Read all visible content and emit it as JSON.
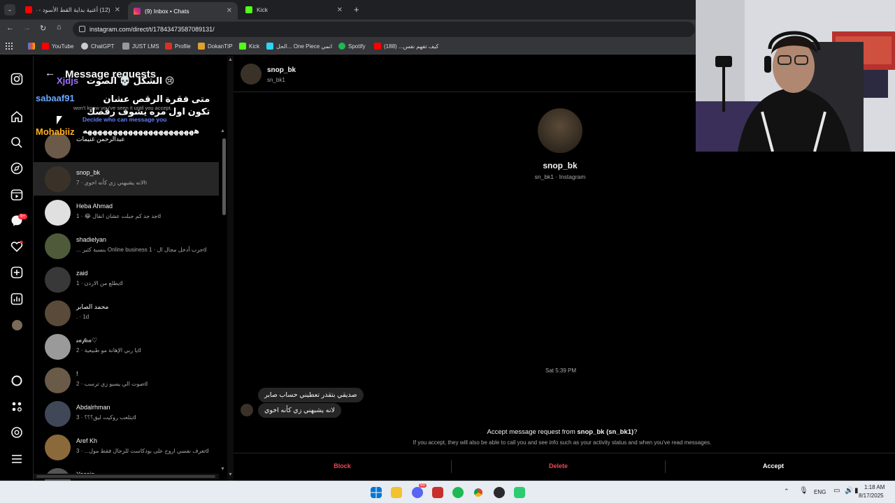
{
  "browser": {
    "tabs": [
      {
        "title": "(12) أغنية بداية القط الأسود - سـ",
        "favicon_color": "#ff0000"
      },
      {
        "title": "(9) Inbox • Chats",
        "favicon_color": "#d6249f",
        "active": true
      },
      {
        "title": "Kick",
        "favicon_color": "#53fc18"
      }
    ],
    "url": "instagram.com/direct/t/17843473587089131/",
    "bookmarks": [
      {
        "label": "YouTube",
        "color": "#ff0000"
      },
      {
        "label": "ChatGPT",
        "color": "#cccccc"
      },
      {
        "label": "JUST LMS",
        "color": "#999999"
      },
      {
        "label": "Profile",
        "color": "#d93025"
      },
      {
        "label": "DokanTIP",
        "color": "#e0a030"
      },
      {
        "label": "Kick",
        "color": "#53fc18"
      },
      {
        "label": "الحل... One Piece انمي",
        "color": "#2dd4f5"
      },
      {
        "label": "Spotify",
        "color": "#1db954"
      },
      {
        "label": "كيف تفهم نفس... (188)",
        "color": "#ff0000"
      }
    ]
  },
  "rail": {
    "badge_count": "9+"
  },
  "requests": {
    "title": "Message requests",
    "subtitle": "won't know you've seen it until you accept.",
    "decide_link": "Decide who can message you",
    "items": [
      {
        "name": "عبدالرحمن غنيمات",
        "preview": "",
        "avatar_color": "#6b5a4a"
      },
      {
        "name": "snop_bk",
        "preview": "لانه يشبهني زي كأنه اخوي · 7h",
        "avatar_color": "#3a3228",
        "selected": true
      },
      {
        "name": "Heba Ahmad",
        "preview": "جد جد كم جبلت عشان انقال 😂 · 1d",
        "avatar_color": "#e0e0e0"
      },
      {
        "name": "shadielyan",
        "preview": "... بنسبة كثير Online business جرب أدخل مجال ال · 1d",
        "avatar_color": "#4e5a3a"
      },
      {
        "name": "zaid",
        "preview": "يطلع من الاردن · 1d",
        "avatar_color": "#383838"
      },
      {
        "name": "محمد الصابر",
        "preview": ". · 1d",
        "avatar_color": "#5a4a3a"
      },
      {
        "name": "𝓈𝒶𝒻𝒶𝒶♡",
        "preview": "يا ربي الإهانة مو طبيعية · 2d",
        "avatar_color": "#9a9a9a"
      },
      {
        "name": "!",
        "preview": "صوت الي يسبو زي ترسب · 2d",
        "avatar_color": "#6a5a48"
      },
      {
        "name": "Abdalrhman",
        "preview": "يتلعب روكيت ليق؟؟؟ · 3d",
        "avatar_color": "#404858"
      },
      {
        "name": "Aref Kh",
        "preview": "تعرف نفسي اروح على بودكاست للرجال فقط مول... · 3d",
        "avatar_color": "#8a6a3a"
      },
      {
        "name": "Yassin ...",
        "preview": "",
        "avatar_color": "#555555"
      }
    ]
  },
  "overlay_chat": [
    {
      "user": "Xjdjs",
      "text": "الشكل 💀 الصوت 😢",
      "user_color": "#a070ff"
    },
    {
      "user": "sabaaf91",
      "text": "متى فقرة الرقص عشان تكون اول مره يشوف رقصك",
      "user_color": "#6aa8ff"
    },
    {
      "user": "Mohabiiz",
      "text": "ههههههههههههههههههههههه",
      "user_color": "#ffb020"
    }
  ],
  "chat": {
    "header_name": "snop_bk",
    "header_handle": "sn_bk1",
    "profile_name": "snop_bk",
    "profile_sub": "sn_bk1 · Instagram",
    "timestamp": "Sat 5:39 PM",
    "messages": [
      "صديقي بتقدر تعطيني حساب صابر",
      "لانه يشبهني زي كأنه اخوي"
    ],
    "request_title_prefix": "Accept message request from ",
    "request_title_user": "snop_bk (sn_bk1)",
    "request_title_suffix": "?",
    "request_body": "If you accept, they will also be able to call you and see info such as your activity status and when you've read messages.",
    "block_label": "Block",
    "delete_label": "Delete",
    "accept_label": "Accept"
  },
  "taskbar": {
    "language": "ENG",
    "time": "1:18 AM",
    "date": "8/17/2025",
    "discord_badge": "99"
  }
}
